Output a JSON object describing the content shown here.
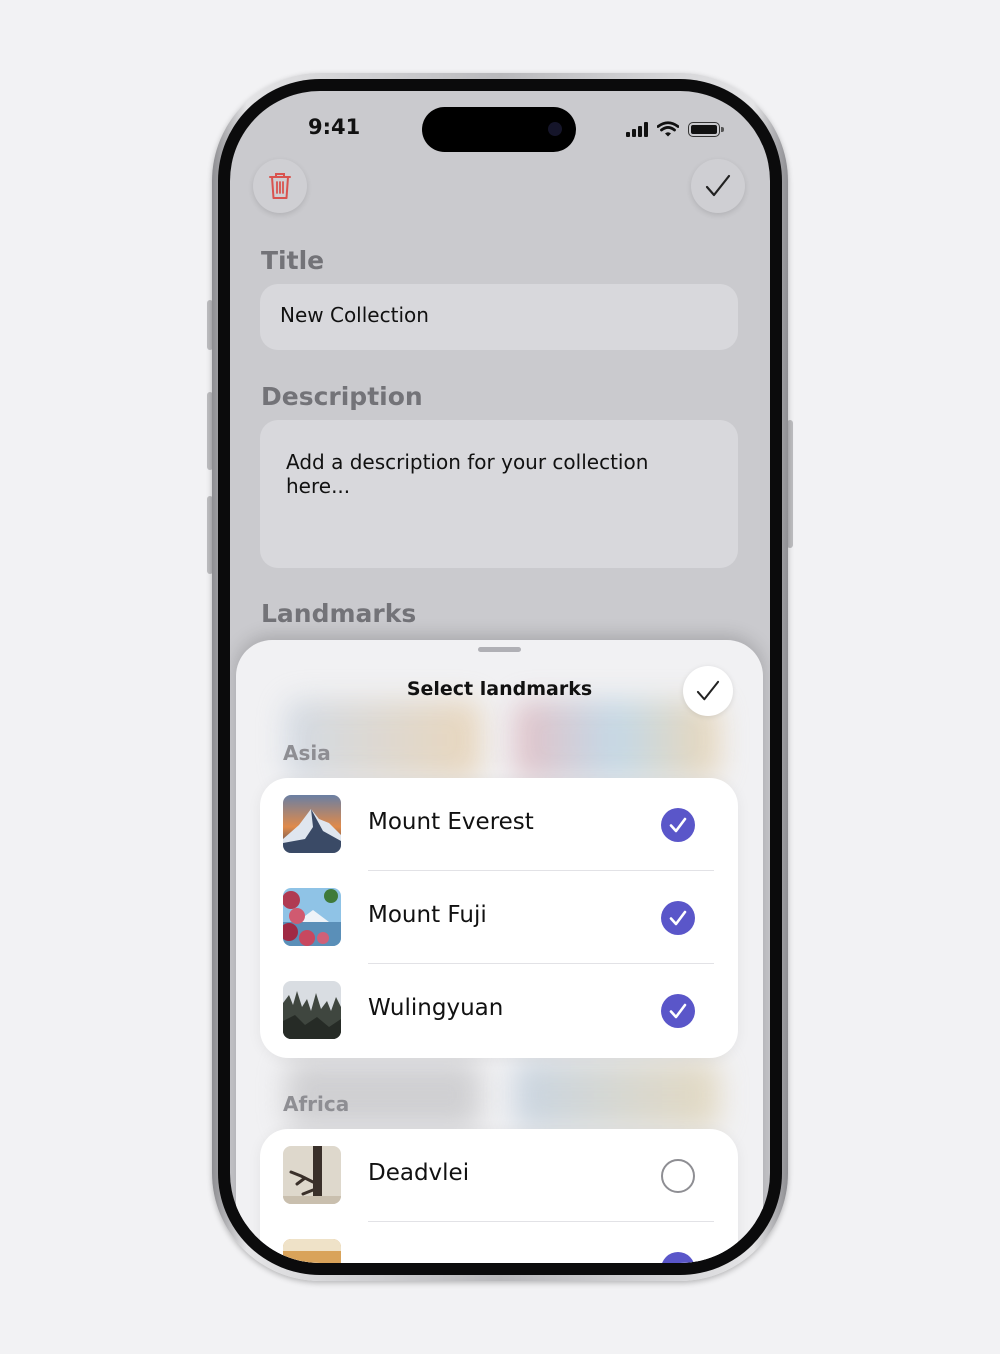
{
  "status_bar": {
    "time": "9:41"
  },
  "toolbar": {
    "delete_icon": "trash-icon",
    "done_icon": "checkmark-icon"
  },
  "form": {
    "title_label": "Title",
    "title_value": "New Collection",
    "description_label": "Description",
    "description_placeholder": "Add a description for your collection here...",
    "landmarks_label": "Landmarks"
  },
  "sheet": {
    "title": "Select landmarks",
    "done_icon": "checkmark-icon",
    "groups": [
      {
        "name": "Asia",
        "items": [
          {
            "name": "Mount Everest",
            "selected": true
          },
          {
            "name": "Mount Fuji",
            "selected": true
          },
          {
            "name": "Wulingyuan",
            "selected": true
          }
        ]
      },
      {
        "name": "Africa",
        "items": [
          {
            "name": "Deadvlei",
            "selected": false
          },
          {
            "name": "",
            "selected": true
          }
        ]
      }
    ]
  },
  "colors": {
    "accent": "#5a56c9",
    "destructive": "#d9534f",
    "background": "#f2f2f4"
  }
}
